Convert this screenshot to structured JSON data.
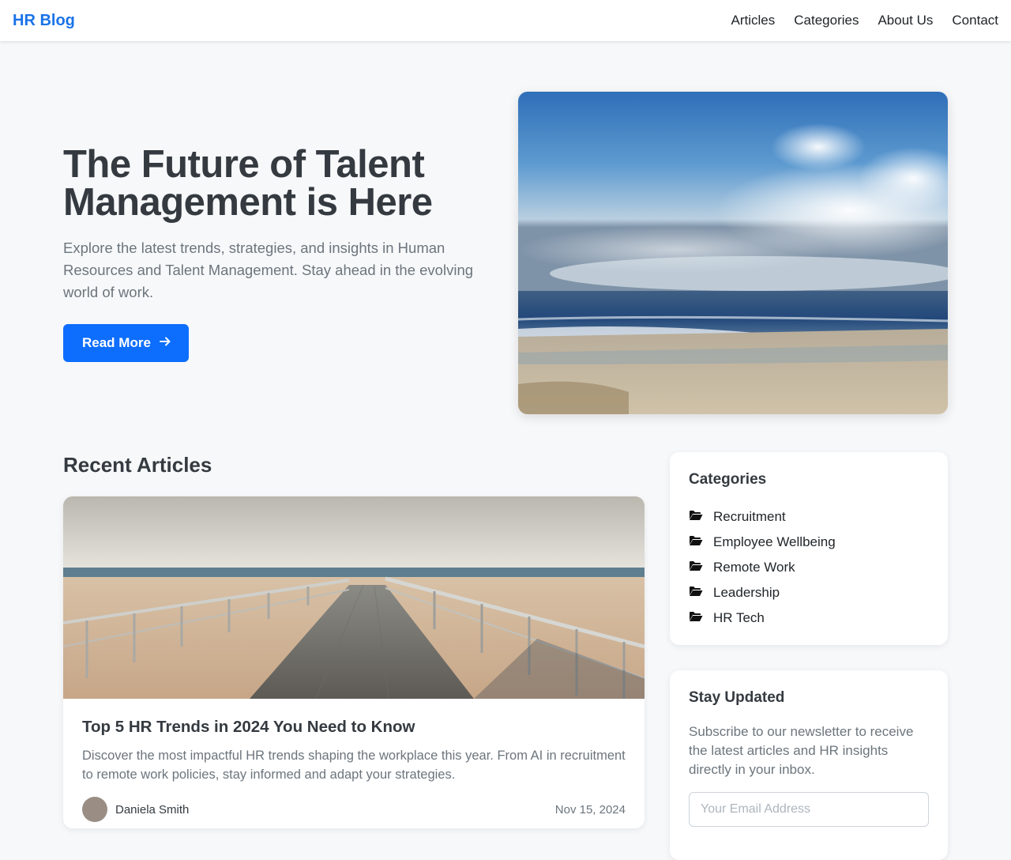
{
  "navbar": {
    "brand": "HR Blog",
    "links": [
      "Articles",
      "Categories",
      "About Us",
      "Contact"
    ],
    "brand_color": "#1a73e8"
  },
  "hero": {
    "title": "The Future of Talent Management is Here",
    "subtitle": "Explore the latest trends, strategies, and insights in Human Resources and Talent Management. Stay ahead in the evolving world of work.",
    "button_label": "Read More",
    "button_icon": "arrow-right-icon",
    "accent_color": "#0d6efd"
  },
  "recent": {
    "section_title": "Recent Articles",
    "article": {
      "title": "Top 5 HR Trends in 2024 You Need to Know",
      "excerpt": "Discover the most impactful HR trends shaping the workplace this year. From AI in recruitment to remote work policies, stay informed and adapt your strategies.",
      "author": "Daniela Smith",
      "date": "Nov 15, 2024"
    }
  },
  "sidebar": {
    "categories": {
      "title": "Categories",
      "icon": "folder-open-icon",
      "items": [
        "Recruitment",
        "Employee Wellbeing",
        "Remote Work",
        "Leadership",
        "HR Tech"
      ]
    },
    "newsletter": {
      "title": "Stay Updated",
      "text": "Subscribe to our newsletter to receive the latest articles and HR insights directly in your inbox.",
      "input_placeholder": "Your Email Address"
    }
  }
}
